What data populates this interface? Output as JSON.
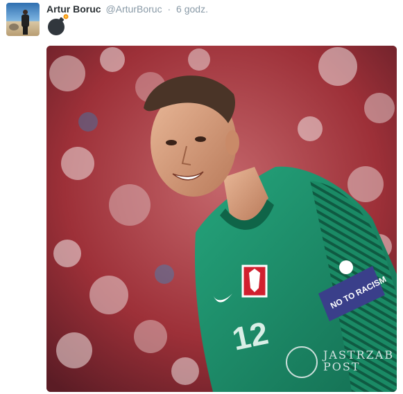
{
  "tweet": {
    "author_name": "Artur Boruc",
    "handle": "@ArturBoruc",
    "separator": "·",
    "time": "6 godz.",
    "emoji_icon": "bomb-icon",
    "media": {
      "jersey_number": "12",
      "armband_text": "NO TO RACISM",
      "watermark": "JASTRZAB POST"
    }
  },
  "colors": {
    "name": "#292f33",
    "meta": "#8899a6",
    "jersey": "#1f9a72",
    "crowd": "#a3313a"
  }
}
